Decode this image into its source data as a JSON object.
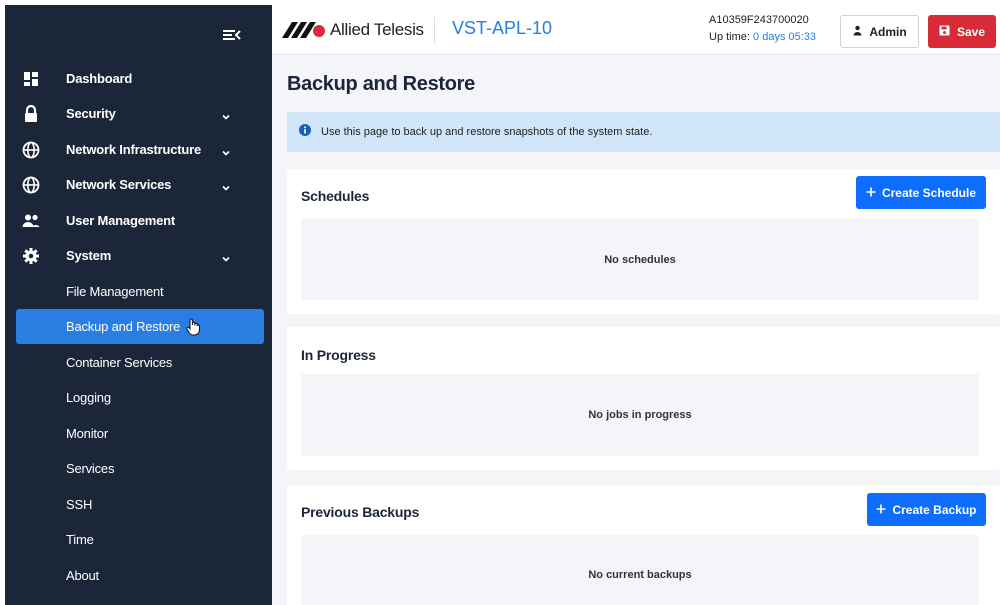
{
  "sidebar": {
    "nav": [
      {
        "label": "Dashboard",
        "icon": "dashboard-icon"
      },
      {
        "label": "Security",
        "icon": "lock-icon"
      },
      {
        "label": "Network Infrastructure",
        "icon": "globe-icon"
      },
      {
        "label": "Network Services",
        "icon": "globe-icon"
      },
      {
        "label": "User Management",
        "icon": "users-icon"
      },
      {
        "label": "System",
        "icon": "gear-icon"
      }
    ],
    "system_items": [
      {
        "label": "File Management"
      },
      {
        "label": "Backup and Restore"
      },
      {
        "label": "Container Services"
      },
      {
        "label": "Logging"
      },
      {
        "label": "Monitor"
      },
      {
        "label": "Services"
      },
      {
        "label": "SSH"
      },
      {
        "label": "Time"
      },
      {
        "label": "About"
      }
    ]
  },
  "header": {
    "brand": "Allied Telesis",
    "device_name": "VST-APL-10",
    "serial": "A10359F243700020",
    "uptime_label": "Up time:",
    "uptime_value": "0 days 05:33",
    "admin_label": "Admin",
    "save_label": "Save"
  },
  "page": {
    "title": "Backup and Restore",
    "info": "Use this page to back up and restore snapshots of the system state."
  },
  "cards": {
    "schedules": {
      "title": "Schedules",
      "button": "Create Schedule",
      "empty": "No schedules"
    },
    "in_progress": {
      "title": "In Progress",
      "empty": "No jobs in progress"
    },
    "previous": {
      "title": "Previous Backups",
      "button": "Create Backup",
      "empty": "No current backups"
    }
  },
  "colors": {
    "sidebar_bg": "#1b2638",
    "accent": "#2a7de1",
    "primary_button": "#0d6efd",
    "save_button": "#d92b37",
    "info_bg": "#d0e6f8"
  }
}
